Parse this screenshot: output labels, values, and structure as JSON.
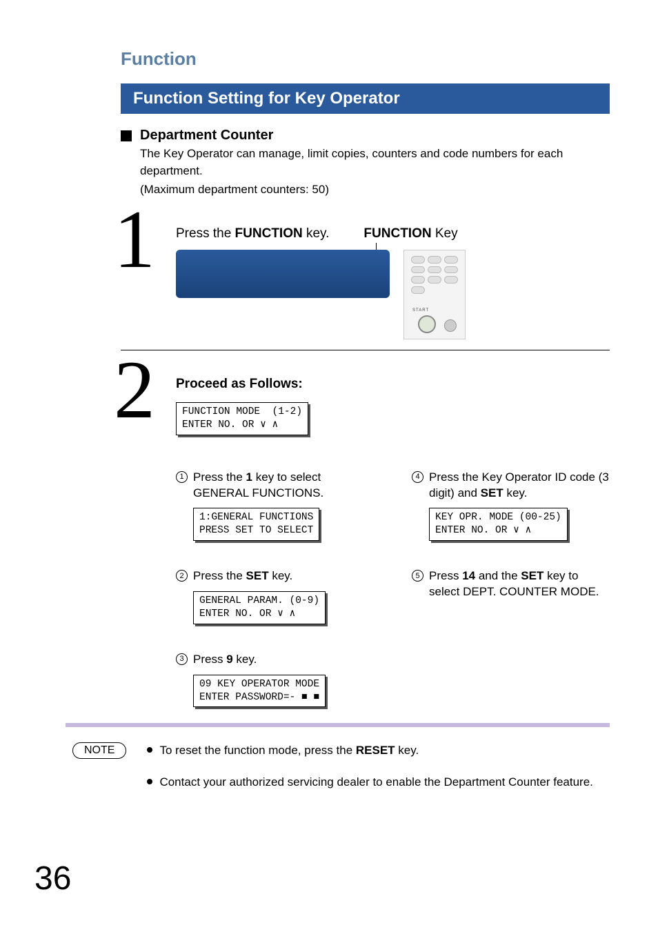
{
  "page_number": "36",
  "section_heading": "Function",
  "title_bar": "Function Setting for Key Operator",
  "subsection": {
    "title": "Department Counter",
    "desc_line1": "The Key Operator can manage, limit copies, counters and code numbers for each department.",
    "desc_line2": "(Maximum department counters: 50)"
  },
  "step1": {
    "text_prefix": "Press the ",
    "text_bold": "FUNCTION",
    "text_suffix": " key.",
    "callout_bold": "FUNCTION",
    "callout_suffix": " Key",
    "start_label": "START"
  },
  "step2": {
    "heading": "Proceed as Follows:",
    "lcd_line1": "FUNCTION MODE  (1-2)",
    "lcd_line2": "ENTER NO. OR ∨ ∧",
    "substeps": {
      "s1": {
        "num": "1",
        "text_a": "Press the ",
        "text_b": "1",
        "text_c": " key to select GENERAL FUNCTIONS.",
        "lcd_l1": "1:GENERAL FUNCTIONS",
        "lcd_l2": "PRESS SET TO SELECT"
      },
      "s2": {
        "num": "2",
        "text_a": "Press the ",
        "text_b": "SET",
        "text_c": " key.",
        "lcd_l1": "GENERAL PARAM. (0-9)",
        "lcd_l2": "ENTER NO. OR ∨ ∧"
      },
      "s3": {
        "num": "3",
        "text_a": "Press ",
        "text_b": "9",
        "text_c": " key.",
        "lcd_l1": "09 KEY OPERATOR MODE",
        "lcd_l2": "ENTER PASSWORD=- ■ ■"
      },
      "s4": {
        "num": "4",
        "text_a": "Press the Key Operator ID code (3 digit) and ",
        "text_b": "SET",
        "text_c": " key.",
        "lcd_l1": "KEY OPR. MODE (00-25)",
        "lcd_l2": "ENTER NO. OR ∨ ∧"
      },
      "s5": {
        "num": "5",
        "text_a": "Press ",
        "text_b": "14",
        "text_c": " and the ",
        "text_d": "SET",
        "text_e": " key to select DEPT. COUNTER MODE."
      }
    }
  },
  "note": {
    "label": "NOTE",
    "item1_a": "To reset the function mode, press the ",
    "item1_b": "RESET",
    "item1_c": " key.",
    "item2": "Contact your authorized servicing dealer to enable the Department Counter feature."
  }
}
